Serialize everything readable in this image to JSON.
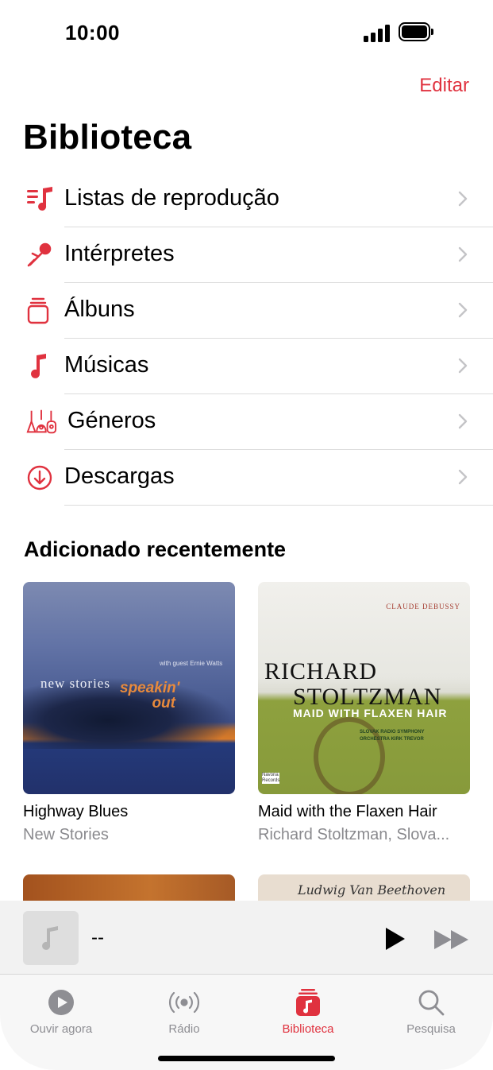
{
  "status_bar": {
    "time": "10:00"
  },
  "header": {
    "edit_label": "Editar",
    "title": "Biblioteca"
  },
  "library_items": [
    {
      "label": "Listas de reprodução",
      "icon": "playlist-icon"
    },
    {
      "label": "Intérpretes",
      "icon": "microphone-icon"
    },
    {
      "label": "Álbuns",
      "icon": "album-stack-icon"
    },
    {
      "label": "Músicas",
      "icon": "music-note-icon"
    },
    {
      "label": "Géneros",
      "icon": "genres-icon"
    },
    {
      "label": "Descargas",
      "icon": "download-icon"
    }
  ],
  "recent": {
    "title": "Adicionado recentemente",
    "albums": [
      {
        "title": "Highway Blues",
        "subtitle": "New Stories",
        "cover_text": "new stories",
        "cover_text2": "speakin' out",
        "cover_small": "with guest Ernie Watts"
      },
      {
        "title": "Maid with the Flaxen Hair",
        "subtitle": "Richard Stoltzman, Slova...",
        "cover_top": "CLAUDE DEBUSSY",
        "cover_line1": "RICHARD",
        "cover_line2": "STOLTZMAN",
        "cover_line3": "MAID WITH FLAXEN HAIR",
        "cover_small": "SLOVAK RADIO SYMPHONY ORCHESTRA KIRK TREVOR",
        "cover_label": "Navona Records"
      },
      {
        "title": "",
        "subtitle": ""
      },
      {
        "title": "",
        "subtitle": "",
        "cover_text": "Ludwig Van Beethoven"
      }
    ]
  },
  "mini_player": {
    "track": "--"
  },
  "tab_bar": {
    "tabs": [
      {
        "label": "Ouvir agora",
        "icon": "play-circle-icon",
        "active": false
      },
      {
        "label": "Rádio",
        "icon": "radio-waves-icon",
        "active": false
      },
      {
        "label": "Biblioteca",
        "icon": "library-icon",
        "active": true
      },
      {
        "label": "Pesquisa",
        "icon": "search-icon",
        "active": false
      }
    ]
  },
  "colors": {
    "accent": "#e0323f",
    "secondary_text": "#8a8a8e"
  }
}
